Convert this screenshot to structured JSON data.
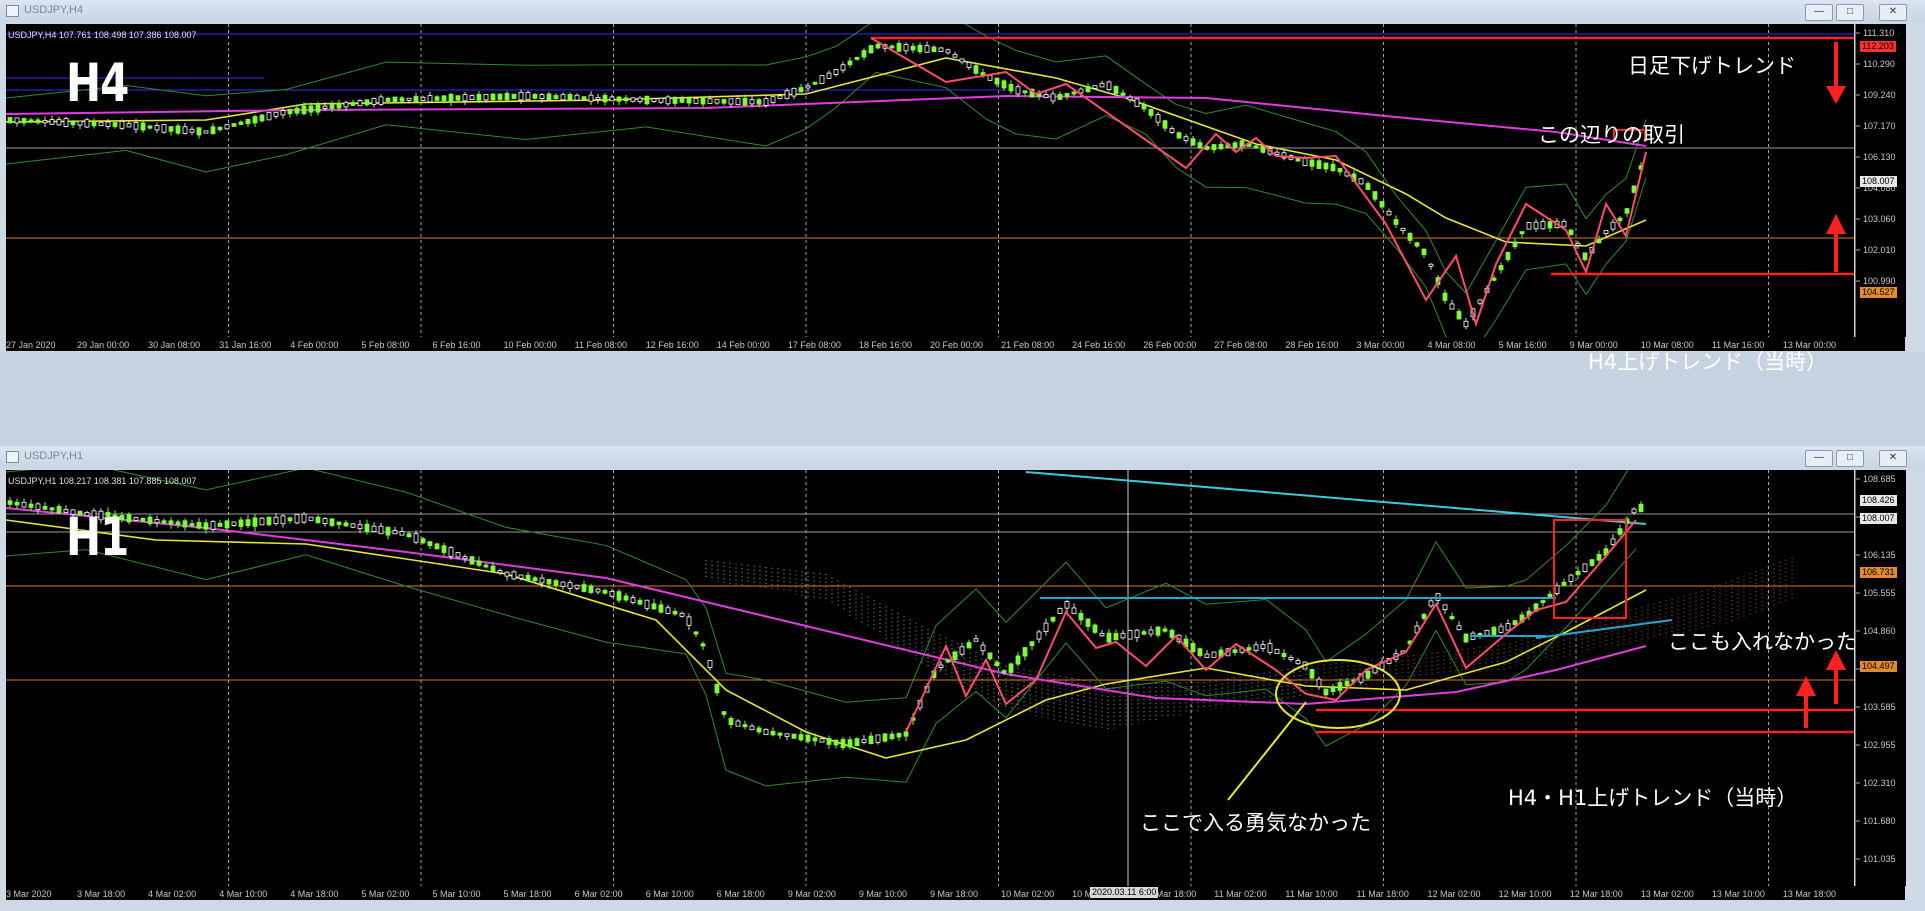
{
  "top": {
    "window_title": "USDJPY,H4",
    "header": "USDJPY,H4  107.761 108.498 107.386 108.007",
    "timeframe_label": "H4",
    "price_ticks": [
      "111.310",
      "110.290",
      "109.240",
      "107.170",
      "106.130",
      "104.080",
      "103.060",
      "102.010",
      "100.990"
    ],
    "badges": {
      "red": "112.203",
      "gray": "108.007",
      "orange": "104.527"
    },
    "time_ticks": [
      "27 Jan 2020",
      "29 Jan 00:00",
      "30 Jan 08:00",
      "31 Jan 16:00",
      "4 Feb 00:00",
      "5 Feb 08:00",
      "6 Feb 16:00",
      "10 Feb 00:00",
      "11 Feb 08:00",
      "12 Feb 16:00",
      "14 Feb 00:00",
      "17 Feb 08:00",
      "18 Feb 16:00",
      "20 Feb 00:00",
      "21 Feb 08:00",
      "24 Feb 16:00",
      "26 Feb 00:00",
      "27 Feb 08:00",
      "28 Feb 16:00",
      "3 Mar 00:00",
      "4 Mar 08:00",
      "5 Mar 16:00",
      "9 Mar 00:00",
      "10 Mar 08:00",
      "11 Mar 16:00",
      "13 Mar 00:00"
    ],
    "annotations": {
      "downtrend": "日足下げトレンド",
      "this_area": "この辺りの取引",
      "uptrend": "H4上げトレンド（当時）"
    }
  },
  "bottom": {
    "window_title": "USDJPY,H1",
    "header": "USDJPY,H1  108.217 108.381 107.885 108.007",
    "timeframe_label": "H1",
    "price_ticks": [
      "108.685",
      "107.410",
      "106.135",
      "105.555",
      "104.860",
      "104.230",
      "103.585",
      "102.955",
      "102.310",
      "101.680",
      "101.035"
    ],
    "badges": {
      "gray1": "108.426",
      "gray2": "108.007",
      "orange1": "106.731",
      "orange2": "104.497"
    },
    "time_ticks": [
      "3 Mar 2020",
      "3 Mar 18:00",
      "4 Mar 02:00",
      "4 Mar 10:00",
      "4 Mar 18:00",
      "5 Mar 02:00",
      "5 Mar 10:00",
      "5 Mar 18:00",
      "6 Mar 02:00",
      "6 Mar 10:00",
      "6 Mar 18:00",
      "9 Mar 02:00",
      "9 Mar 10:00",
      "9 Mar 18:00",
      "10 Mar 02:00",
      "10 Mar 10:00",
      "10 Mar 18:00",
      "11 Mar 02:00",
      "11 Mar 10:00",
      "11 Mar 18:00",
      "12 Mar 02:00",
      "12 Mar 10:00",
      "12 Mar 18:00",
      "13 Mar 02:00",
      "13 Mar 10:00",
      "13 Mar 18:00"
    ],
    "crosshair_time": "2020.03.11 6:00",
    "annotations": {
      "no_entry_here": "ここも入れなかった",
      "no_courage": "ここで入る勇気なかった",
      "uptrend": "H4・H1上げトレンド（当時）"
    }
  },
  "colors": {
    "bull": "#7cfc3a",
    "bear": "#ffffff",
    "ma_yellow": "#e6e636",
    "ma_magenta": "#e03ce0",
    "bollinger": "#2e8b2e",
    "trend_red": "#ff2020",
    "zigzag": "#ff4d6d",
    "cyan": "#1ea8d8",
    "orange_line": "#d87a1c"
  }
}
